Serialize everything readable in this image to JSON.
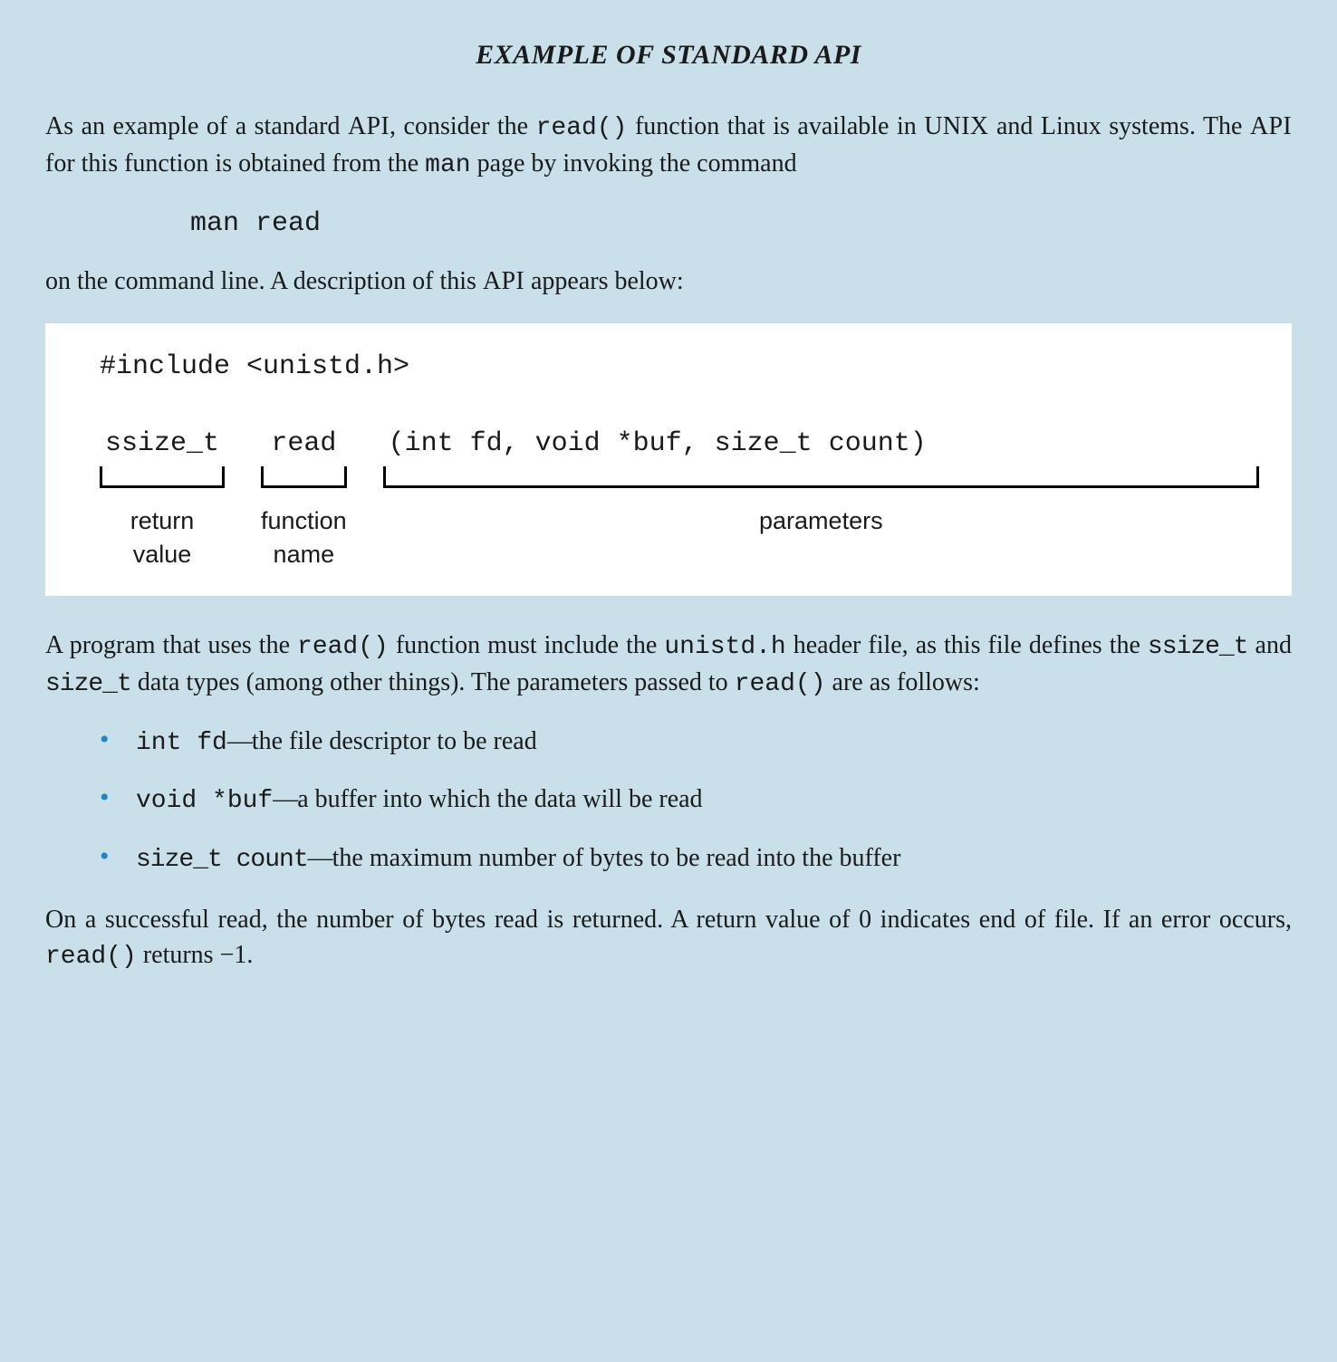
{
  "title": "EXAMPLE OF STANDARD API",
  "intro": {
    "pre": "As an example of a standard ",
    "api1": "API",
    "t1": ", consider the ",
    "read": "read()",
    "t2": " function that is available in ",
    "unix": "UNIX",
    "t3": " and Linux systems. The ",
    "api2": "API",
    "t4": " for this function is obtained from the ",
    "man": "man",
    "t5": " page by invoking the command"
  },
  "command": "man read",
  "line2": {
    "t1": "on the command line. A description of this ",
    "api": "API",
    "t2": " appears below:"
  },
  "diagram": {
    "include": "#include <unistd.h>",
    "return_type": "ssize_t",
    "func_name": "read",
    "params_sig": "(int fd, void *buf, size_t count)",
    "label_return": "return\nvalue",
    "label_func": "function\nname",
    "label_params": "parameters"
  },
  "para2": {
    "t1": "A program that uses the ",
    "read": "read()",
    "t2": " function must include the ",
    "header": "unistd.h",
    "t3": " header file, as this file defines the ",
    "ssize": "ssize_t",
    "t4": " and ",
    "size": "size_t",
    "t5": " data types (among other things). The parameters passed to ",
    "read2": "read()",
    "t6": " are as follows:"
  },
  "bullets": [
    {
      "code": "int fd",
      "dash": "—",
      "text": "the file descriptor to be read"
    },
    {
      "code": "void *buf",
      "dash": "—",
      "text": "a buffer into which the data will be read"
    },
    {
      "code": "size_t count",
      "dash": "—",
      "text": "the maximum number of bytes to be read into the buffer"
    }
  ],
  "closing": {
    "t1": "On a successful read, the number of bytes read is returned. A return value of 0 indicates end of file. If an error occurs, ",
    "read": "read()",
    "t2": " returns −1."
  }
}
